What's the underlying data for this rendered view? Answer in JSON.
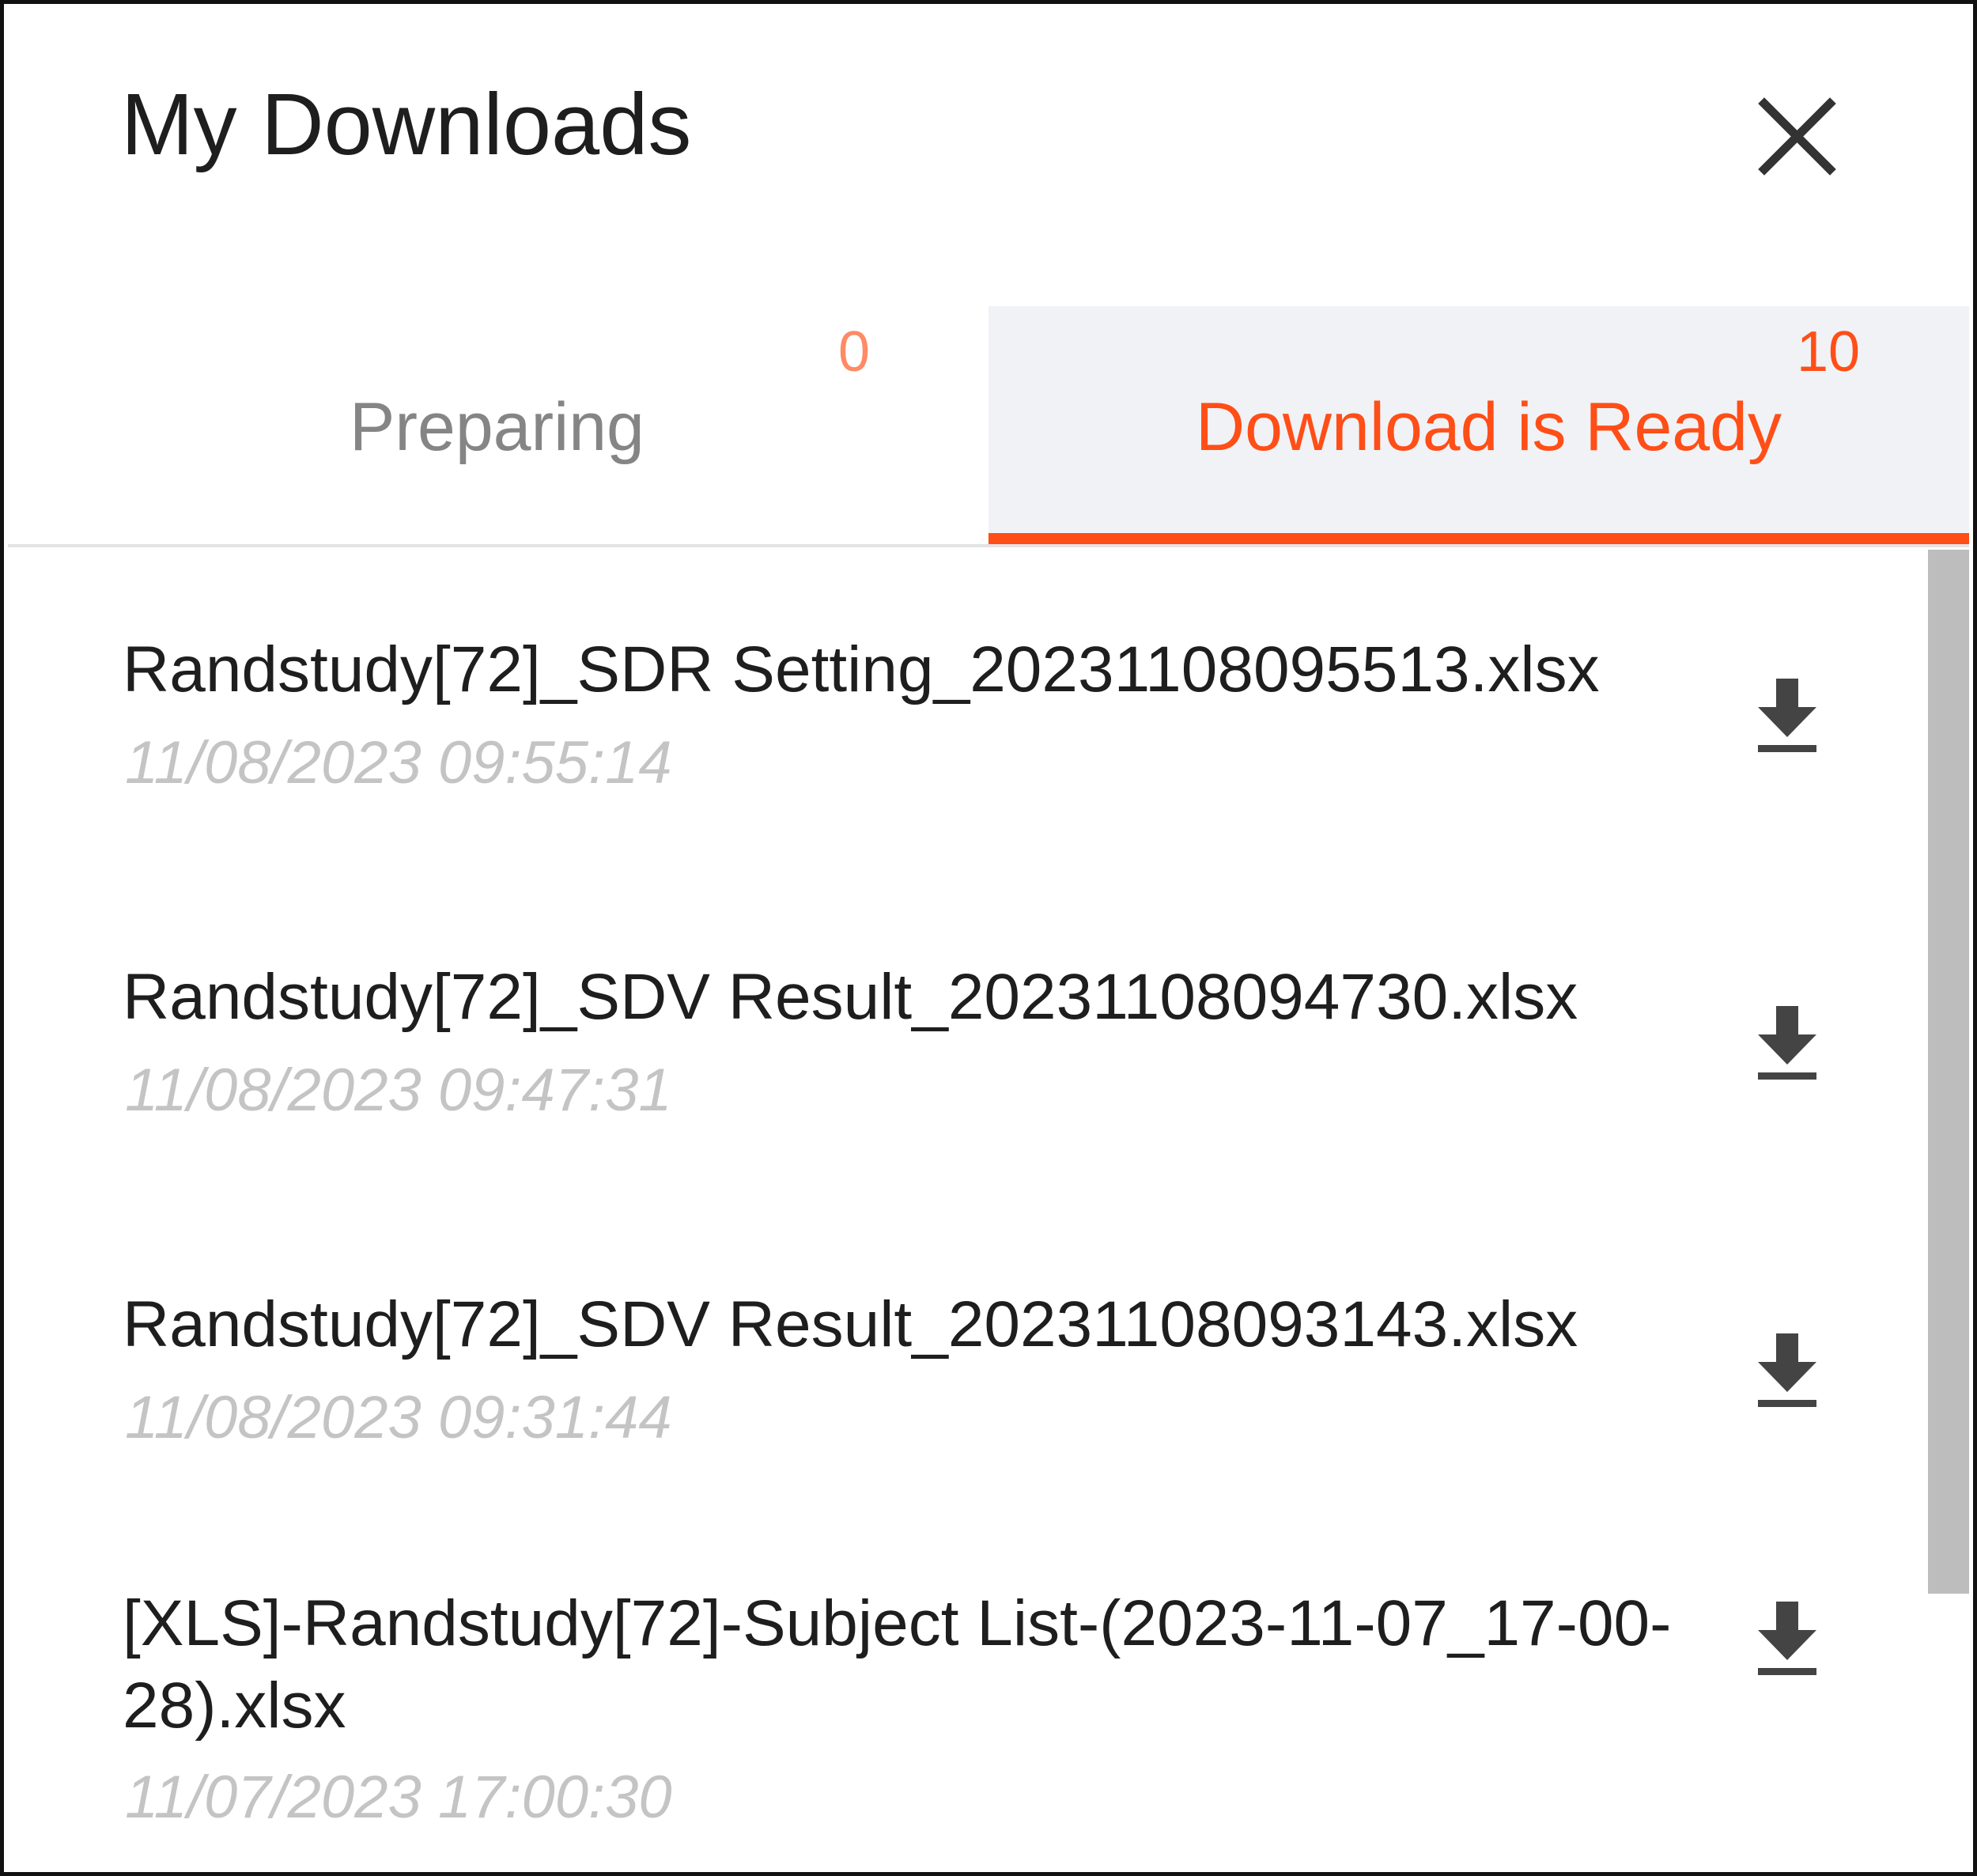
{
  "header": {
    "title": "My Downloads"
  },
  "tabs": {
    "preparing": {
      "label": "Preparing",
      "count": "0"
    },
    "ready": {
      "label": "Download is Ready",
      "count": "10"
    },
    "active": "ready"
  },
  "downloads": [
    {
      "name": "Randstudy[72]_SDR Setting_20231108095513.xlsx",
      "time": "11/08/2023 09:55:14"
    },
    {
      "name": "Randstudy[72]_SDV Result_20231108094730.xlsx",
      "time": "11/08/2023 09:47:31"
    },
    {
      "name": "Randstudy[72]_SDV Result_20231108093143.xlsx",
      "time": "11/08/2023 09:31:44"
    },
    {
      "name": "[XLS]-Randstudy[72]-Subject List-(2023-11-07_17-00-28).xlsx",
      "time": "11/07/2023 17:00:30"
    }
  ],
  "icons": {
    "close": "close-icon",
    "download": "download-icon"
  },
  "colors": {
    "accent": "#ff4e17",
    "count_inactive": "#ff8a65",
    "tab_active_bg": "#f1f2f5",
    "timestamp": "#c4c4c4"
  }
}
